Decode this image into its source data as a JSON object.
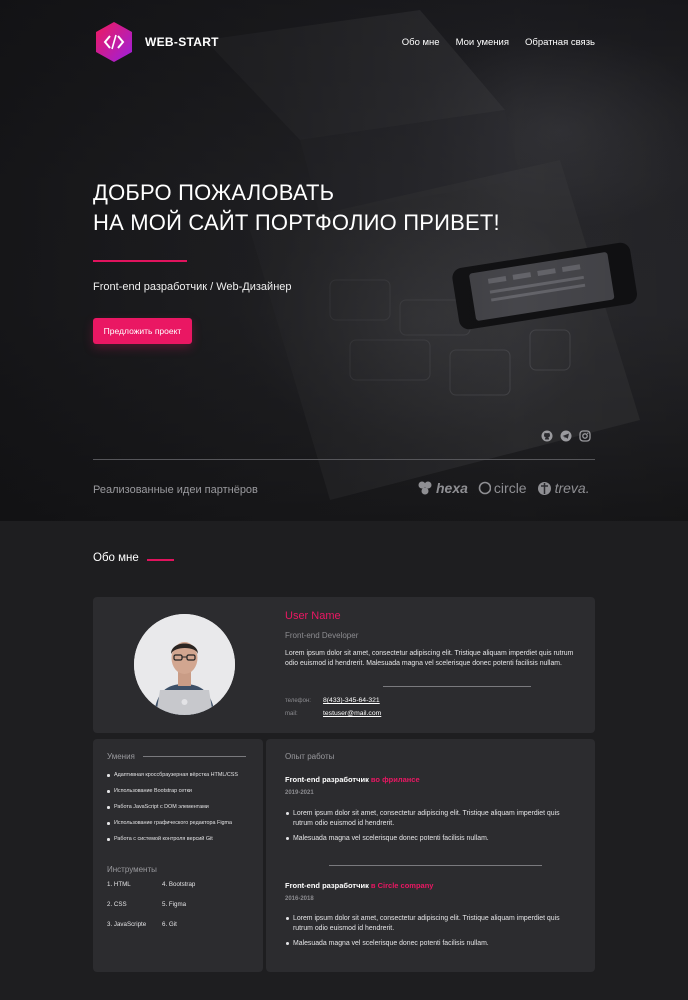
{
  "header": {
    "brand": "WEB-START",
    "logo_icon": "code-brackets-icon",
    "nav": [
      "Обо мне",
      "Мои умения",
      "Обратная связь"
    ]
  },
  "hero": {
    "title_line1": "ДОБРО ПОЖАЛОВАТЬ",
    "title_line2": "НА МОЙ САЙТ ПОРТФОЛИО ПРИВЕТ!",
    "subtitle": "Front-end разработчик / Web-Дизайнер",
    "cta_label": "Предложить проект",
    "social_icons": [
      "github-icon",
      "telegram-icon",
      "instagram-icon"
    ],
    "partners_label": "Реализованные идеи партнёров",
    "partners": [
      "hexa",
      "circle",
      "treva."
    ]
  },
  "about": {
    "heading": "Обо мне",
    "user_name": "User Name",
    "role": "Front-end Developer",
    "bio": "Lorem ipsum dolor sit amet, consectetur adipiscing elit. Tristique aliquam imperdiet quis rutrum odio euismod id hendrerit. Malesuada magna vel scelerisque donec potenti facilisis nullam.",
    "phone_label": "телефон:",
    "phone": "8(433)-345-64-321",
    "mail_label": "mail:",
    "mail": "testuser@mail.com"
  },
  "skills": {
    "title": "Умения",
    "items": [
      "Адаптивная кроссбраузерная вёрстка HTML/CSS",
      "Использование Bootstrap сетки",
      "Работа JavaScript с DOM элементами",
      "Использование графического редактора Figma",
      "Работа с системой контроля версий Git"
    ],
    "tools_title": "Инструменты",
    "tools": [
      "1. HTML",
      "4. Bootstrap",
      "2. CSS",
      "5. Figma",
      "3. JavaScripte",
      "6. Git"
    ]
  },
  "experience": {
    "title": "Опыт работы",
    "jobs": [
      {
        "role": "Front-end разработчик ",
        "place": "во фрилансе",
        "dates": "2019-2021",
        "points": [
          "Lorem ipsum dolor sit amet, consectetur adipiscing elit. Tristique aliquam imperdiet quis rutrum odio euismod id hendrerit.",
          "Malesuada magna vel scelerisque donec potenti facilisis nullam."
        ]
      },
      {
        "role": "Front-end разработчик ",
        "place": "в Circle company",
        "dates": "2016-2018",
        "points": [
          "Lorem ipsum dolor sit amet, consectetur adipiscing elit. Tristique aliquam imperdiet quis rutrum odio euismod id hendrerit.",
          "Malesuada magna vel scelerisque donec potenti facilisis nullam."
        ]
      }
    ]
  },
  "colors": {
    "accent": "#ea1763",
    "background": "#1e1e20",
    "card": "#2c2c2f"
  }
}
